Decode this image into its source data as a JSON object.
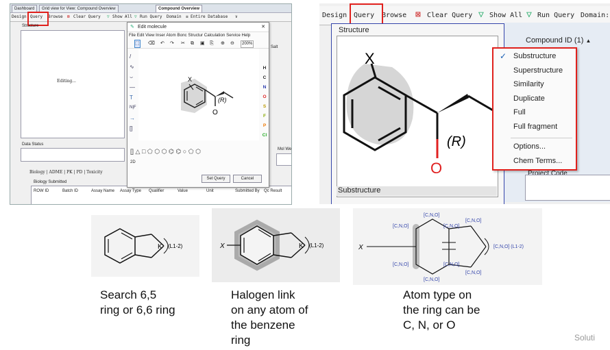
{
  "left": {
    "tabs": [
      "Dashboard",
      "Grid view for View: Compound Overview",
      "Compound Overview"
    ],
    "toolbar": {
      "design": "Design",
      "query": "Query",
      "browse": "Browse",
      "clear_query": "Clear Query",
      "show_all": "Show All",
      "run_query": "Run Query",
      "domain": "Domain",
      "domain_value": "Entire Database"
    },
    "structure_label": "Structure",
    "editing_text": "Editing...",
    "data_status_label": "Data Status",
    "salt_label": "Salt",
    "mol_label": "Mol We",
    "sub_tabs": [
      "Biology",
      "ADME",
      "PK",
      "PD",
      "Toxicity"
    ],
    "biology_submitted": "Biology Submitted",
    "columns": [
      "ROW ID",
      "Batch ID",
      "Assay Name",
      "Assay Type",
      "Qualifier",
      "Value",
      "Unit",
      "Submitted By",
      "Qc Result"
    ],
    "dialog": {
      "title": "Edit molecule",
      "menu": [
        "File",
        "Edit",
        "View",
        "Inser",
        "Atom",
        "Bonc",
        "Structur",
        "Calculation",
        "Service",
        "Help"
      ],
      "zoom": "200%",
      "elements": [
        "H",
        "C",
        "N",
        "O",
        "S",
        "F",
        "P",
        "Cl"
      ],
      "labels_r": "(R)",
      "atom_x": "X",
      "atom_o": "O",
      "mode_2d": "2D",
      "set_query": "Set Query",
      "cancel": "Cancel"
    }
  },
  "right": {
    "toolbar": {
      "design": "Design",
      "query": "Query",
      "browse": "Browse",
      "clear_query": "Clear Query",
      "show_all": "Show All",
      "run_query": "Run Query",
      "domain": "Domain:"
    },
    "structure_label": "Structure",
    "compound_id": "Compound ID (1)",
    "atom_x": "X",
    "atom_o": "O",
    "label_r": "(R)",
    "substructure_footer": "Substructure",
    "project_code": "Project Code",
    "menu": {
      "checked": "Substructure",
      "items": [
        "Substructure",
        "Superstructure",
        "Similarity",
        "Duplicate",
        "Full",
        "Full fragment"
      ],
      "items2": [
        "Options...",
        "Chem Terms..."
      ]
    }
  },
  "diagrams": [
    {
      "annotation": "(L1-2)",
      "atom_k": "K",
      "caption": [
        "Search 6,5",
        "ring or 6,6 ring"
      ]
    },
    {
      "annotation": "(L1-2)",
      "atom_k": "K",
      "atom_x": "X",
      "caption": [
        "Halogen link",
        "on any atom of",
        "the benzene",
        "ring"
      ]
    },
    {
      "atom_x": "X",
      "set": "[C,N,O]",
      "annotation": "[C,N,O] (L1-2)",
      "caption": [
        "Atom type on",
        "the ring can be",
        "C, N, or O"
      ]
    }
  ],
  "corner_text": "Soluti",
  "colors": {
    "highlight_red": "#e0201c",
    "bond_red": "#e02020",
    "frame_blue": "#3344aa"
  }
}
